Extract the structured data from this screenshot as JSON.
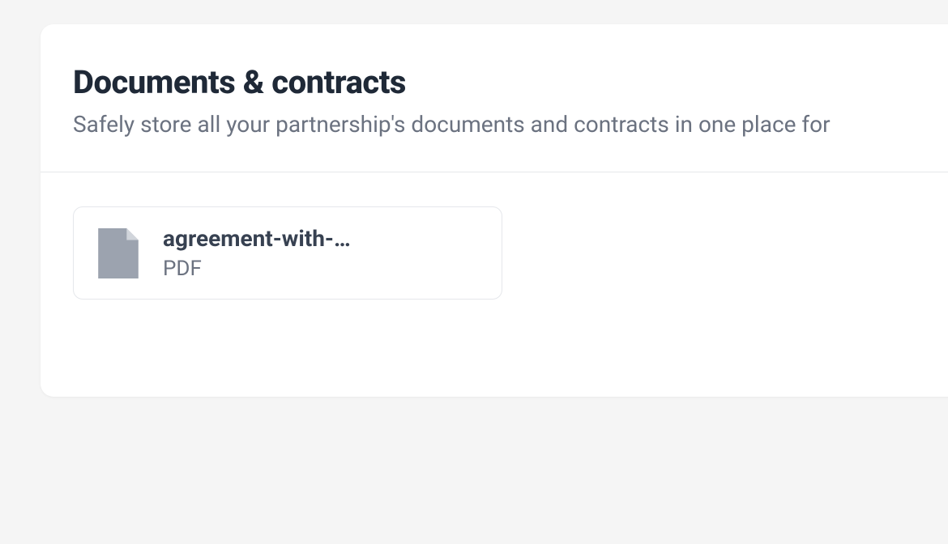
{
  "header": {
    "title": "Documents & contracts",
    "subtitle": "Safely store all your partnership's documents and contracts in one place for"
  },
  "files": [
    {
      "name": "agreement-with-…",
      "type": "PDF"
    }
  ]
}
